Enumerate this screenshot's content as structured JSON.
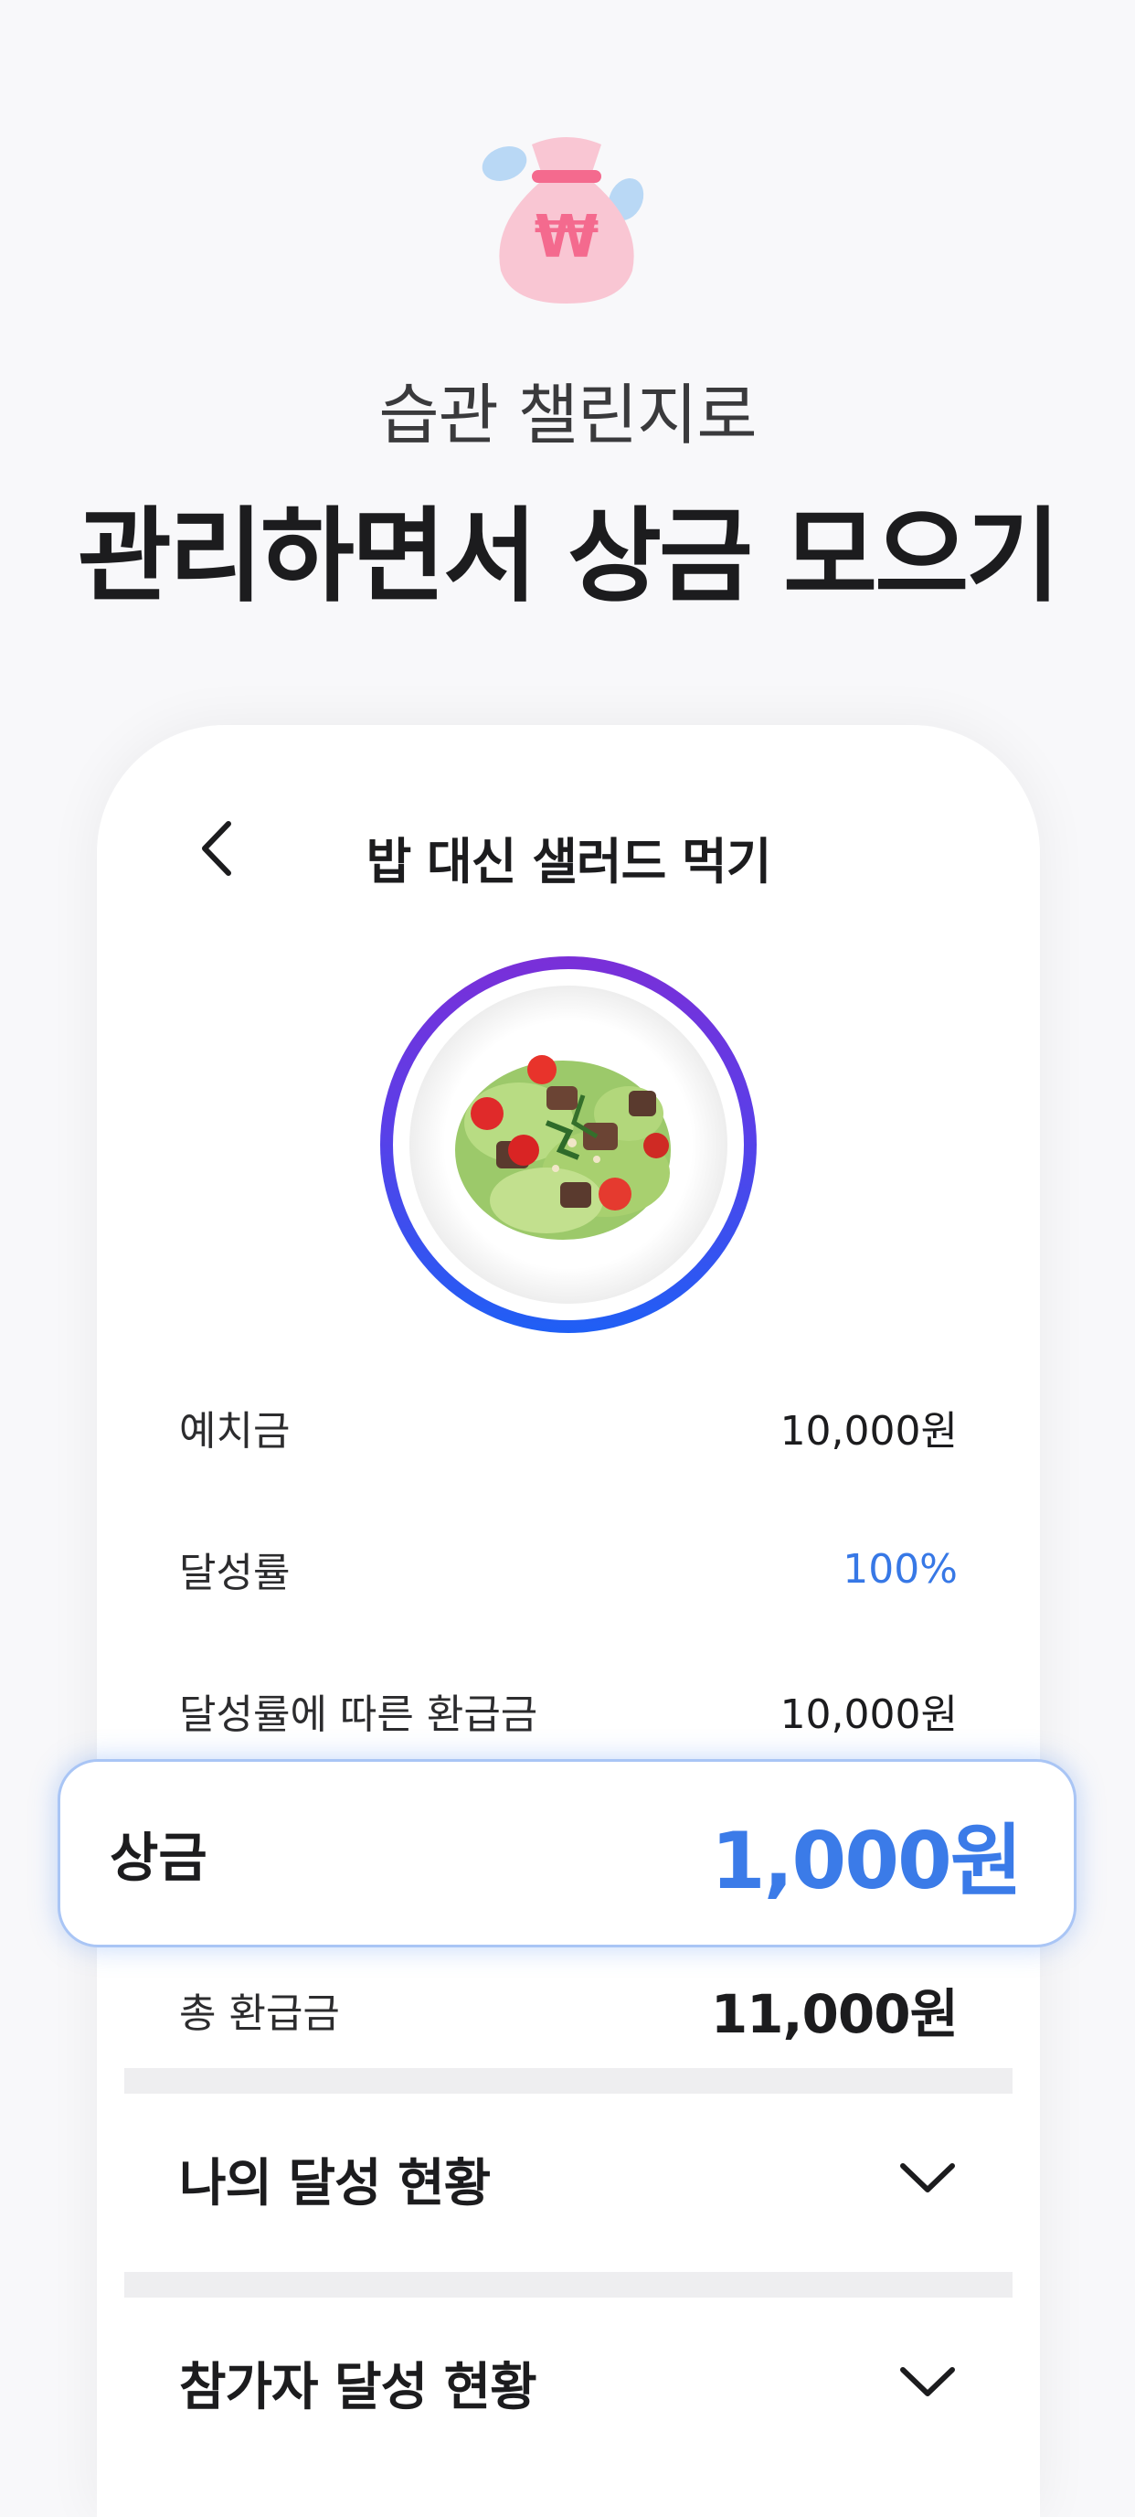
{
  "hero": {
    "subtitle": "습관 챌린지로",
    "title": "관리하면서 상금 모으기",
    "icon": "money-bag-icon",
    "icon_symbol": "₩"
  },
  "screen": {
    "title": "밥 대신 샐러드 먹기",
    "image": "salad-bowl",
    "rows": [
      {
        "label": "예치금",
        "value": "10,000원"
      },
      {
        "label": "달성률",
        "value": "100%"
      },
      {
        "label": "달성률에 따른 환급금",
        "value": "10,000원"
      }
    ],
    "prize": {
      "label": "상금",
      "value": "1,000원"
    },
    "total": {
      "label": "총 환급금",
      "value": "11,000원"
    },
    "sections": [
      {
        "title": "나의 달성 현황"
      },
      {
        "title": "참가자 달성 현황"
      }
    ]
  },
  "colors": {
    "accent": "#3b7be8",
    "ring_top": "#7a2fd8",
    "ring_bottom": "#1f5ff5",
    "bag_pink": "#f9c6d3"
  }
}
